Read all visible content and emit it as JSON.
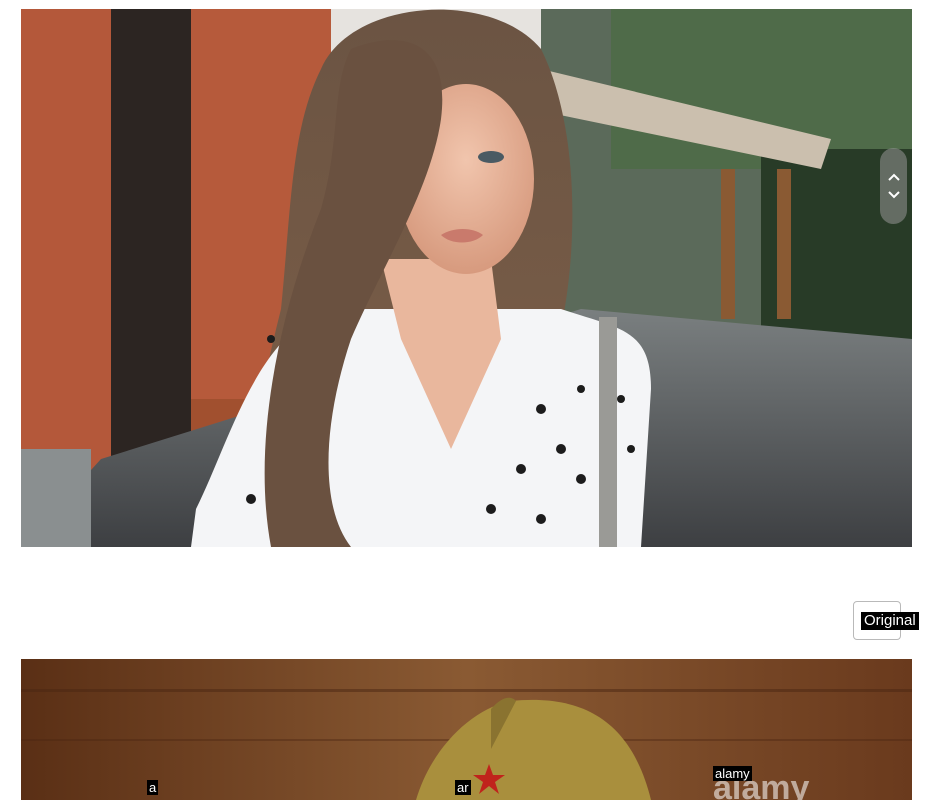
{
  "images": [
    {
      "name": "woman-polka-dot-dress-photo"
    },
    {
      "name": "soldier-cap-photo"
    }
  ],
  "viewer": {
    "original_button_label": "Original",
    "scroll_controls": [
      "scroll-up",
      "scroll-down"
    ]
  },
  "overlay_labels": {
    "tag_a": "a",
    "tag_ar": "ar",
    "tag_alamy": "alamy"
  },
  "colors": {
    "background": "#ffffff",
    "label_bg": "#000000",
    "label_text": "#ffffff"
  }
}
